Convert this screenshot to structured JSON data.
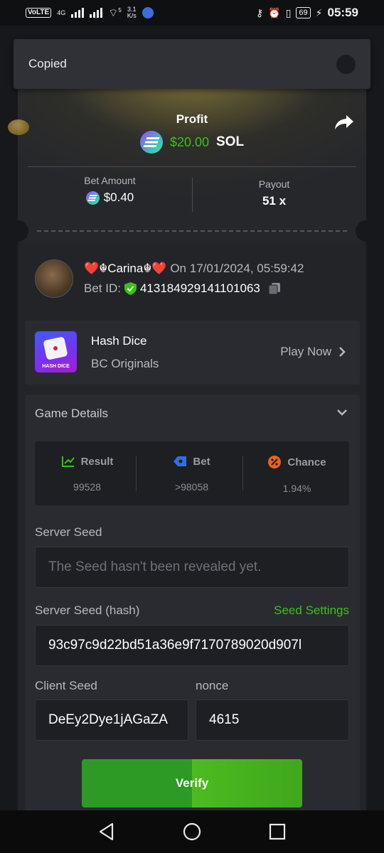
{
  "status_bar": {
    "left_chip": "VoLTE",
    "network_label": "4G",
    "speed_value": "3.1",
    "speed_unit": "K/s",
    "wifi_label": "5",
    "battery": "69",
    "time": "05:59"
  },
  "toast": {
    "text": "Copied"
  },
  "profit": {
    "label": "Profit",
    "amount": "$20.00",
    "currency": "SOL"
  },
  "bet_amount": {
    "label": "Bet Amount",
    "value": "$0.40"
  },
  "payout": {
    "label": "Payout",
    "value": "51 x"
  },
  "user": {
    "name": "❤️☬Carina☬❤️",
    "date_prefix": "On",
    "date": "17/01/2024, 05:59:42",
    "bet_id_label": "Bet ID:",
    "bet_id": "413184929141101063"
  },
  "game": {
    "thumb_text": "HASH DICE",
    "name": "Hash Dice",
    "provider": "BC Originals",
    "play_label": "Play Now"
  },
  "details": {
    "title": "Game Details",
    "result": {
      "label": "Result",
      "value": "99528"
    },
    "bet": {
      "label": "Bet",
      "value": ">98058"
    },
    "chance": {
      "label": "Chance",
      "value": "1.94%"
    },
    "server_seed_label": "Server Seed",
    "server_seed_placeholder": "The Seed hasn't been revealed yet.",
    "server_seed_hash_label": "Server Seed (hash)",
    "seed_settings_label": "Seed Settings",
    "server_seed_hash": "93c97c9d22bd51a36e9f7170789020d907l",
    "client_seed_label": "Client Seed",
    "client_seed": "DeEy2Dye1jAGaZA",
    "nonce_label": "nonce",
    "nonce": "4615",
    "verify_label": "Verify"
  },
  "colors": {
    "accent_green": "#3bc117",
    "background": "#17181b",
    "card": "#232428",
    "field": "#1e1f23"
  },
  "icons": [
    "share-icon",
    "solana-icon",
    "shield-icon",
    "copy-icon",
    "chevron-right-icon",
    "chevron-down-icon",
    "result-icon",
    "bet-tag-icon",
    "percent-icon",
    "back-icon",
    "home-icon",
    "recents-icon"
  ]
}
